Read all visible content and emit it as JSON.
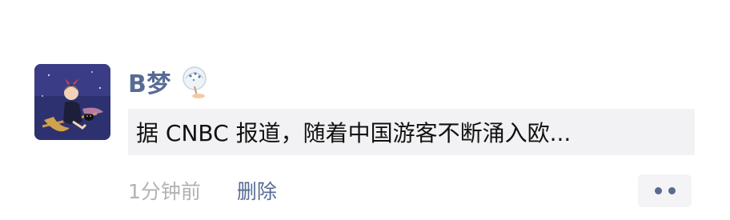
{
  "post": {
    "author_name": "B梦",
    "author_badge_icon": "fan-sticker-icon",
    "avatar_icon": "anime-girl-on-broom-avatar",
    "link_title": "据 CNBC 报道，随着中国游客不断涌入欧...",
    "time": "1分钟前",
    "delete_label": "删除",
    "more_icon": "two-dots-icon"
  },
  "colors": {
    "name": "#576b95",
    "card_bg": "#f2f2f4",
    "time": "#b2b2b2",
    "more_bg": "#f4f4f6"
  }
}
